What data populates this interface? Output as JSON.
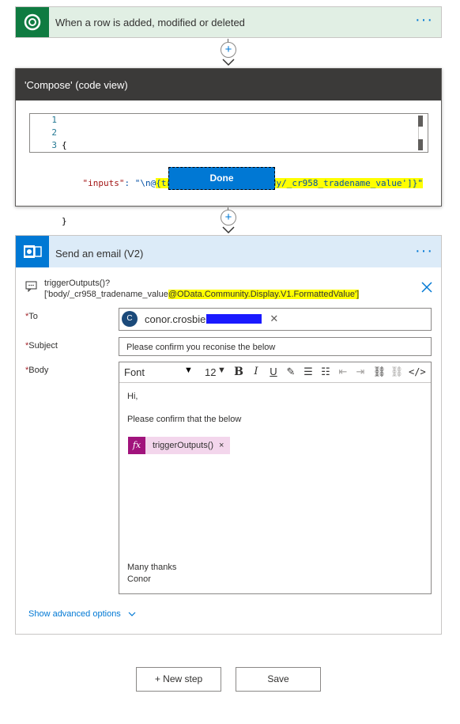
{
  "trigger": {
    "title": "When a row is added, modified or deleted",
    "menu": "···"
  },
  "compose": {
    "title": "'Compose' (code view)",
    "line_numbers": [
      "1",
      "2",
      "3"
    ],
    "line1": "{",
    "line2_key": "\"inputs\"",
    "line2_sep": ": \"\\n@",
    "line2_expr": "{triggerOutputs()?['body/_cr958_tradename_value']}",
    "line2_end": "\"",
    "line3": "}",
    "done_label": "Done"
  },
  "email": {
    "title": "Send an email (V2)",
    "menu": "···",
    "info_line1": "triggerOutputs()?",
    "info_line2_a": "['body/_cr958_tradename_value",
    "info_line2_b": "@OData.Community.Display.V1.FormattedValue']",
    "to_label": "To",
    "to_avatar": "C",
    "to_value": "conor.crosbie",
    "subject_label": "Subject",
    "subject_value": "Please confirm you reconise the below",
    "body_label": "Body",
    "required_marker": "*",
    "toolbar": {
      "font": "Font",
      "size": "12"
    },
    "body_lines": {
      "greeting": "Hi,",
      "line": "Please confirm that the below",
      "token": "triggerOutputs()",
      "token_close": "×",
      "signoff": "Many thanks",
      "name": "Conor"
    },
    "advanced": "Show advanced options"
  },
  "buttons": {
    "new_step": "+ New step",
    "save": "Save"
  },
  "icons": {
    "dataverse": "dataverse-icon",
    "outlook": "outlook-icon",
    "add": "plus-icon",
    "info": "comment-icon",
    "close": "close-icon",
    "chevron": "chevron-down-icon"
  },
  "colors": {
    "accent": "#0078d4",
    "highlight": "#ffff00",
    "trigger": "#0f7b41",
    "fx": "#a1137c"
  }
}
